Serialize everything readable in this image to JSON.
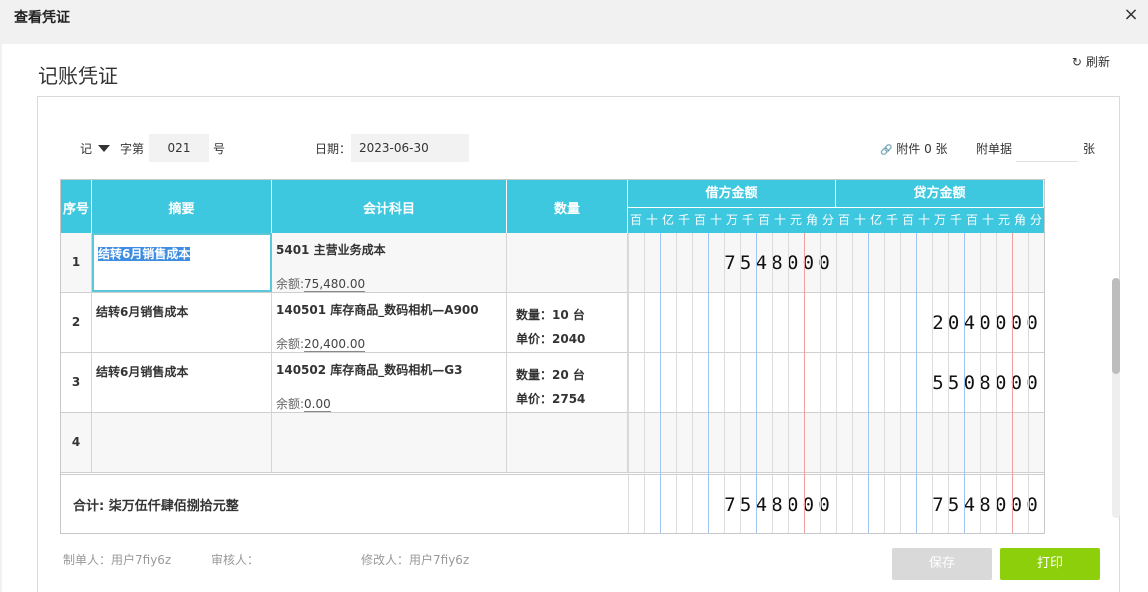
{
  "window": {
    "title": "查看凭证",
    "close_icon": "×"
  },
  "page": {
    "title": "记账凭证",
    "refresh_label": "刷新",
    "refresh_icon": "↻"
  },
  "header": {
    "voucher_type": "记",
    "word_label": "字第",
    "number": "021",
    "number_suffix": "号",
    "date_label": "日期：",
    "date": "2023-06-30",
    "attachment_icon": "🔗",
    "attachment_label": "附件 0 张",
    "attach_doc_label": "附单据",
    "attach_doc_value": "",
    "attach_doc_unit": "张"
  },
  "columns": {
    "seq": "序号",
    "summary": "摘要",
    "account": "会计科目",
    "quantity": "数量",
    "debit": "借方金额",
    "credit": "贷方金额",
    "digits": [
      "百",
      "十",
      "亿",
      "千",
      "百",
      "十",
      "万",
      "千",
      "百",
      "十",
      "元",
      "角",
      "分"
    ]
  },
  "rows": [
    {
      "seq": "1",
      "summary": "结转6月销售成本",
      "account": "5401 主营业务成本",
      "balance_label": "余额:",
      "balance": "75,480.00",
      "qty_line1": "",
      "qty_line2": "",
      "debit": "7548000",
      "credit": ""
    },
    {
      "seq": "2",
      "summary": "结转6月销售成本",
      "account": "140501 库存商品_数码相机—A900",
      "balance_label": "余额:",
      "balance": "20,400.00",
      "qty_line1": "数量：10 台",
      "qty_line2": "单价：2040",
      "debit": "",
      "credit": "2040000"
    },
    {
      "seq": "3",
      "summary": "结转6月销售成本",
      "account": "140502 库存商品_数码相机—G3",
      "balance_label": "余额:",
      "balance": "0.00",
      "qty_line1": "数量：20 台",
      "qty_line2": "单价：2754",
      "debit": "",
      "credit": "5508000"
    },
    {
      "seq": "4",
      "summary": "",
      "account": "",
      "balance_label": "",
      "balance": "",
      "qty_line1": "",
      "qty_line2": "",
      "debit": "",
      "credit": ""
    }
  ],
  "total": {
    "label": "合计:  柒万伍仟肆佰捌拾元整",
    "debit": "7548000",
    "credit": "7548000"
  },
  "footer": {
    "maker": "制单人：用户7fiy6z",
    "reviewer": "审核人：",
    "modifier": "修改人：用户7fiy6z"
  },
  "buttons": {
    "save": "保存",
    "print": "打印"
  },
  "colors": {
    "header_bg": "#3ec8df",
    "print_bg": "#8ccf0a",
    "save_bg": "#d9d9d9"
  }
}
